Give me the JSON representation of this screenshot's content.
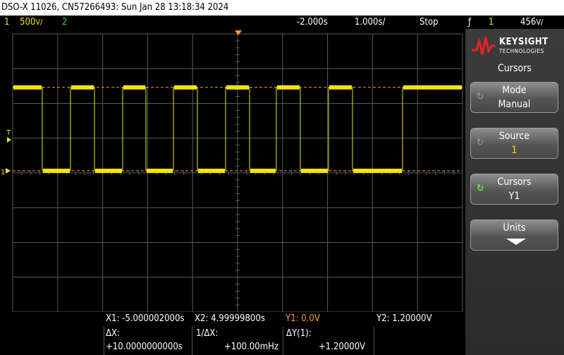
{
  "title_bar": "DSO-X 11026, CN57266493: Sun Jan 28 13:18:34 2024",
  "status": {
    "ch1_num": "1",
    "ch1_scale": "500&#x2F;",
    "ch2_num": "2",
    "delay": "-2.000s",
    "timebase": "1.000s/",
    "run_state": "Stop",
    "trig_icon": "ƒ",
    "trig_src": "1",
    "trig_level": "456&#x2F;"
  },
  "screen_markers": {
    "trigger_marker": "T",
    "ch1_marker": "1"
  },
  "brand": {
    "name": "KEYSIGHT",
    "sub": "TECHNOLOGIES",
    "logo_icon": "keysight-wave-icon"
  },
  "menu": {
    "title": "Cursors",
    "softkeys": [
      {
        "line1": "Mode",
        "line2": "Manual",
        "knob": "↻"
      },
      {
        "line1": "Source",
        "line2": "1",
        "knob": "↻"
      },
      {
        "line1": "Cursors",
        "line2": "Y1",
        "knob": "↻"
      },
      {
        "line1": "Units",
        "line2": ""
      }
    ]
  },
  "cursors": {
    "x1": "X1: -5.000002000s",
    "x2": "X2:  4.99999800s",
    "y1": "Y1:  0.0V",
    "y2": "Y2:  1.20000V",
    "dx_label": "ΔX:",
    "dx_value": "+10.0000000000s",
    "inv_dx_label": "1/ΔX:",
    "inv_dx_value": "+100.00mHz",
    "dy_label": "ΔY(1):",
    "dy_value": "+1.20000V"
  },
  "colors": {
    "ch1": "#f2e400",
    "ch2": "#3ad23a",
    "cursor_y1": "#ff9b2f",
    "grid": "#5a5a5a"
  },
  "waveform": {
    "high_level_v": 1.2,
    "low_level_v": 0.0,
    "period_s": 1.0,
    "duty": 0.5
  }
}
